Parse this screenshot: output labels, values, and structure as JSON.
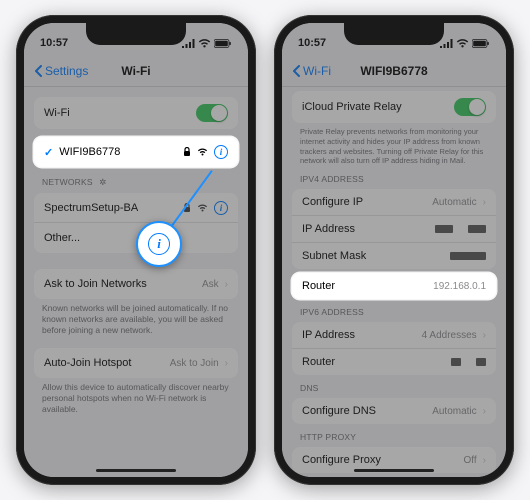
{
  "status": {
    "time": "10:57"
  },
  "left": {
    "back": "Settings",
    "title": "Wi-Fi",
    "wifi_label": "Wi-Fi",
    "connected_ssid": "WIFI9B6778",
    "networks_header": "NETWORKS",
    "network1": "SpectrumSetup-BA",
    "other": "Other...",
    "ask_label": "Ask to Join Networks",
    "ask_value": "Ask",
    "ask_footer": "Known networks will be joined automatically. If no known networks are available, you will be asked before joining a new network.",
    "hotspot_label": "Auto-Join Hotspot",
    "hotspot_value": "Ask to Join",
    "hotspot_footer": "Allow this device to automatically discover nearby personal hotspots when no Wi-Fi network is available."
  },
  "right": {
    "back": "Wi-Fi",
    "title": "WIFI9B6778",
    "relay_label": "iCloud Private Relay",
    "relay_footer": "Private Relay prevents networks from monitoring your internet activity and hides your IP address from known trackers and websites. Turning off Private Relay for this network will also turn off IP address hiding in Mail.",
    "ipv4_header": "IPV4 ADDRESS",
    "configure_ip_label": "Configure IP",
    "configure_ip_value": "Automatic",
    "ip_label": "IP Address",
    "subnet_label": "Subnet Mask",
    "router_label": "Router",
    "router_value": "192.168.0.1",
    "ipv6_header": "IPV6 ADDRESS",
    "ipv6_ip_label": "IP Address",
    "ipv6_ip_value": "4 Addresses",
    "ipv6_router_label": "Router",
    "dns_header": "DNS",
    "dns_label": "Configure DNS",
    "dns_value": "Automatic",
    "proxy_header": "HTTP PROXY",
    "proxy_label": "Configure Proxy",
    "proxy_value": "Off"
  }
}
